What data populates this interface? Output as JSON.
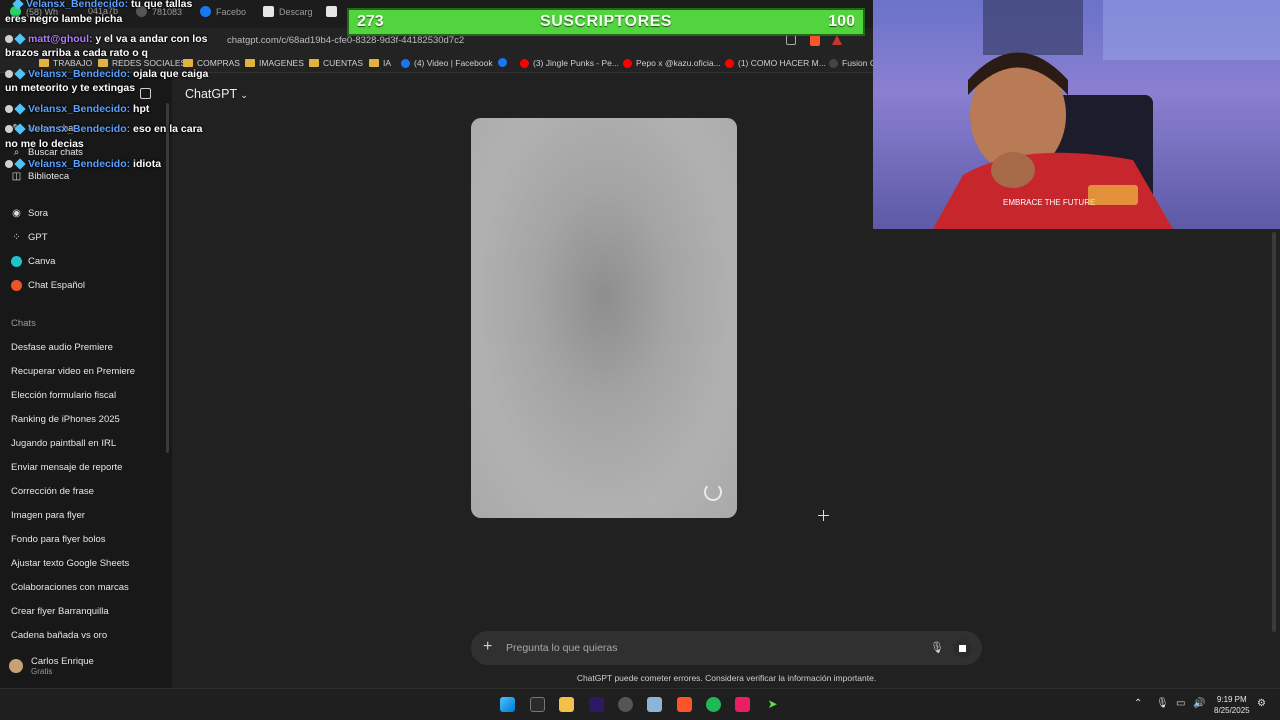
{
  "browser": {
    "tabs": [
      "(58) Wh",
      "781083",
      "041a7b",
      "Facebo",
      "Descarg"
    ],
    "url": "chatgpt.com/c/68ad19b4-cfe0-8328-9d3f-44182530d7c2",
    "bookmarks": [
      {
        "label": "TRABAJO",
        "icon": "folder-icon"
      },
      {
        "label": "REDES SOCIALES",
        "icon": "folder-icon"
      },
      {
        "label": "COMPRAS",
        "icon": "folder-icon"
      },
      {
        "label": "IMAGENES",
        "icon": "folder-icon"
      },
      {
        "label": "CUENTAS",
        "icon": "folder-icon"
      },
      {
        "label": "IA",
        "icon": "folder-icon"
      },
      {
        "label": "(4) Video | Facebook",
        "icon": "facebook-icon"
      },
      {
        "label": "(3) Jingle Punks - Pe...",
        "icon": "facebook-icon"
      },
      {
        "label": "Pepo x @kazu.oficia...",
        "icon": "youtube-icon"
      },
      {
        "label": "(1) COMO HACER M...",
        "icon": "youtube-icon"
      },
      {
        "label": "Fusion Cl",
        "icon": "site-icon"
      }
    ]
  },
  "sidebar": {
    "partial_item": "Nuevo chat",
    "search": "Buscar chats",
    "library": "Biblioteca",
    "apps": [
      {
        "label": "Sora",
        "icon": "sora-icon"
      },
      {
        "label": "GPT",
        "icon": "grid-icon"
      },
      {
        "label": "Canva",
        "icon": "canva-icon"
      },
      {
        "label": "Chat Español",
        "icon": "chat-espanol-icon"
      }
    ],
    "chats_label": "Chats",
    "chats": [
      "Desfase audio Premiere",
      "Recuperar video en Premiere",
      "Elección formulario fiscal",
      "Ranking de iPhones 2025",
      "Jugando paintball en IRL",
      "Enviar mensaje de reporte",
      "Corrección de frase",
      "Imagen para flyer",
      "Fondo para flyer bolos",
      "Ajustar texto Google Sheets",
      "Colaboraciones con marcas",
      "Crear flyer Barranquilla",
      "Cadena bañada vs oro"
    ],
    "user": {
      "name": "Carlos Enrique",
      "plan": "Gratis"
    }
  },
  "main": {
    "model": "ChatGPT",
    "input_placeholder": "Pregunta lo que quieras",
    "disclaimer": "ChatGPT puede cometer errores. Considera verificar la información importante."
  },
  "subs": {
    "count": "273",
    "label": "SUSCRIPTORES",
    "goal": "100",
    "bar_color": "#52d43e"
  },
  "stream_chat": [
    {
      "user": "Velansx_Bendecido:",
      "msg": "tu que tallas"
    },
    {
      "user": "",
      "msg": "eres negro lambe picha"
    },
    {
      "user": "matt@ghoul:",
      "msg": "y el va a andar con los"
    },
    {
      "user": "",
      "msg": "brazos arriba a cada rato o q"
    },
    {
      "user": "Velansx_Bendecido:",
      "msg": "ojala que caiga"
    },
    {
      "user": "",
      "msg": "un meteorito y te extingas"
    },
    {
      "user": "Velansx_Bendecido:",
      "msg": "hpt"
    },
    {
      "user": "Velansx_Bendecido:",
      "msg": "eso en la cara"
    },
    {
      "user": "",
      "msg": "no me lo decias"
    },
    {
      "user": "Velansx_Bendecido:",
      "msg": "idiota"
    }
  ],
  "webcam": {
    "shirt_text": "EMBRACE THE FUTURE"
  },
  "taskbar": {
    "apps": [
      "windows-start-icon",
      "epic-icon",
      "file-explorer-icon",
      "premiere-icon",
      "obs-icon",
      "notepad-icon",
      "brave-icon",
      "spotify-icon",
      "capcut-icon",
      "green-arrow-icon"
    ],
    "time": "9:19 PM",
    "date": "8/25/2025"
  }
}
